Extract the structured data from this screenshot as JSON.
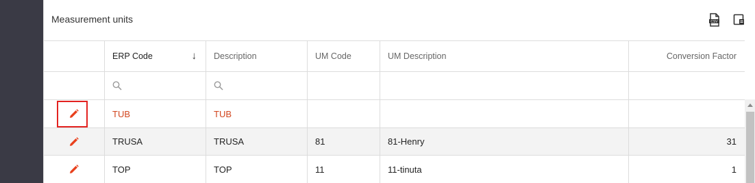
{
  "panel": {
    "title": "Measurement units",
    "csv_export_icon": "csv-export-icon",
    "column_chooser_icon": "column-chooser-icon"
  },
  "grid": {
    "columns": {
      "erp_code": "ERP Code",
      "description": "Description",
      "um_code": "UM Code",
      "um_description": "UM Description",
      "conversion_factor": "Conversion Factor"
    },
    "sort": {
      "column": "ERP Code",
      "direction": "descending",
      "icon": "arrow-down-icon"
    },
    "filter_icon": "search-icon",
    "rows": [
      {
        "erp_code": "TUB",
        "description": "TUB",
        "um_code": "",
        "um_description": "",
        "conversion_factor": "",
        "selected": true
      },
      {
        "erp_code": "TRUSA",
        "description": "TRUSA",
        "um_code": "81",
        "um_description": "81-Henry",
        "conversion_factor": "31"
      },
      {
        "erp_code": "TOP",
        "description": "TOP",
        "um_code": "11",
        "um_description": "11-tinuta",
        "conversion_factor": "1"
      }
    ]
  },
  "colors": {
    "accent": "#d2461e",
    "edit_icon": "#e8401c",
    "highlight": "#e3211f",
    "sidebar": "#3a3a45"
  }
}
